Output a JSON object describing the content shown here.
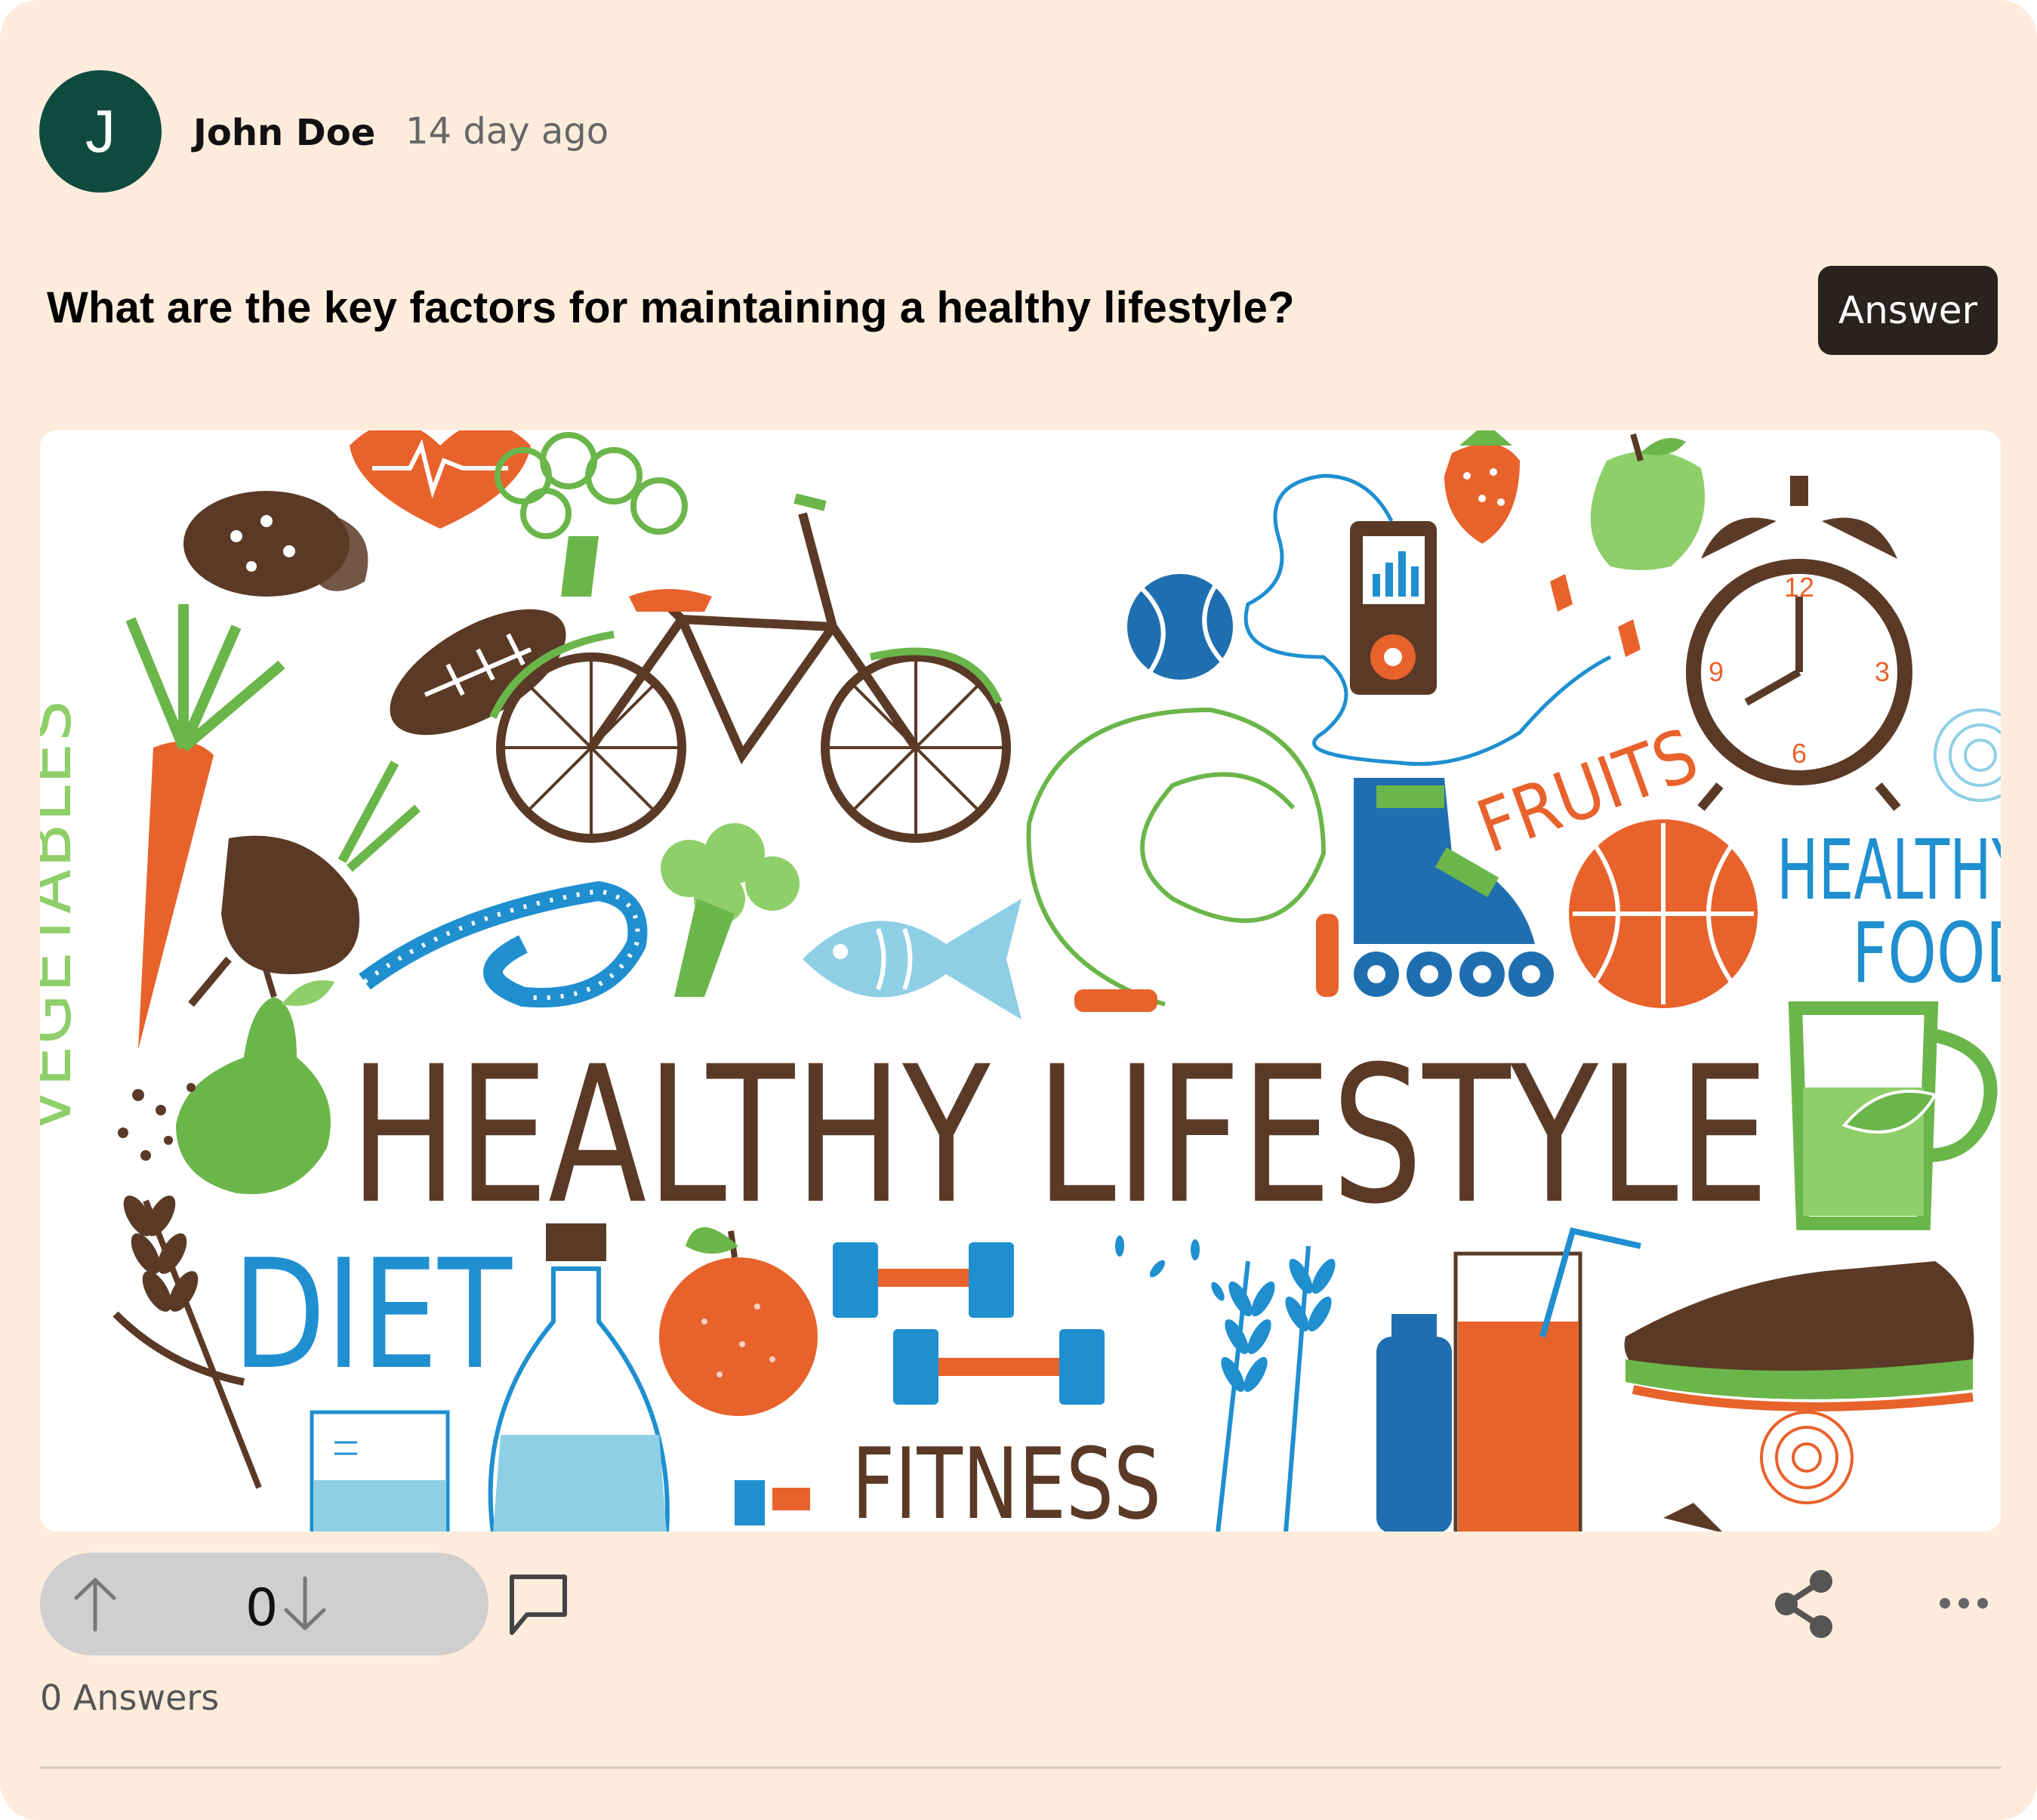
{
  "post": {
    "author": {
      "initial": "J",
      "name": "John Doe",
      "avatar_color": "#0f4a3f"
    },
    "time": "14 day ago",
    "question": "What are the key factors for maintaining a healthy lifestyle?",
    "answer_button": "Answer",
    "illustration_icon": "healthy-lifestyle-illustration",
    "illustration_words": {
      "vegetables": "VEGETABLES",
      "main": "HEALTHY LIFESTYLE",
      "diet": "DIET",
      "fitness": "FITNESS",
      "fruits": "FRUITS",
      "healthy_food_line1": "HEALTHY",
      "healthy_food_line2": "FOOD"
    },
    "votes": {
      "count": "0",
      "upvote_icon": "arrow-up-icon",
      "downvote_icon": "arrow-down-icon"
    },
    "answers_count": "0 Answers",
    "comment_icon": "comment-icon",
    "share_icon": "share-icon",
    "more_icon": "more-icon"
  },
  "colors": {
    "card_background": "#fdecdc",
    "button_background": "#2a2220",
    "vote_pill": "#cfcfcf",
    "illustration_brown": "#5a3a26",
    "illustration_orange": "#e8622c",
    "illustration_green": "#6bb64a",
    "illustration_blue": "#1f8fd0",
    "illustration_lightblue": "#8fcfe6"
  }
}
